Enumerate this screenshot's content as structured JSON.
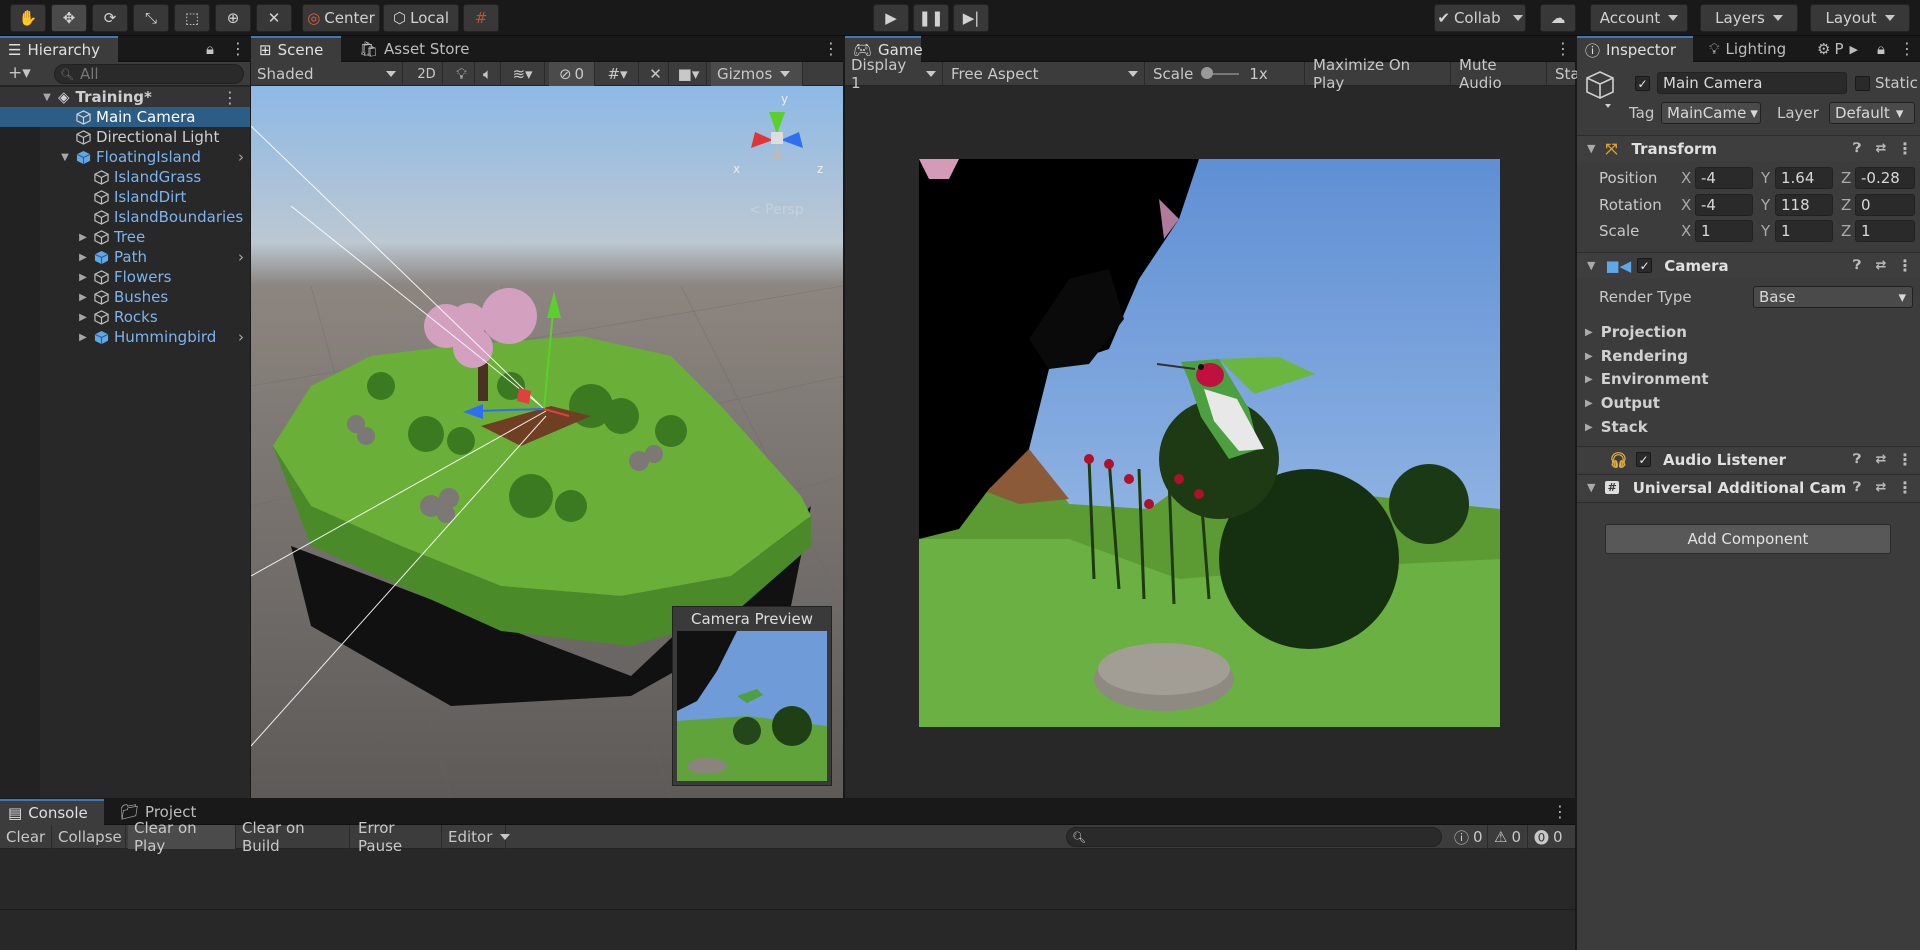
{
  "toolbar": {
    "pivot_label": "Center",
    "space_label": "Local",
    "collab_label": "Collab",
    "account_label": "Account",
    "layers_label": "Layers",
    "layout_label": "Layout"
  },
  "hierarchy": {
    "tab": "Hierarchy",
    "search_placeholder": "All",
    "scene": "Training*",
    "items": [
      {
        "label": "Main Camera"
      },
      {
        "label": "Directional Light"
      },
      {
        "label": "FloatingIsland"
      },
      {
        "label": "IslandGrass"
      },
      {
        "label": "IslandDirt"
      },
      {
        "label": "IslandBoundaries"
      },
      {
        "label": "Tree"
      },
      {
        "label": "Path"
      },
      {
        "label": "Flowers"
      },
      {
        "label": "Bushes"
      },
      {
        "label": "Rocks"
      },
      {
        "label": "Hummingbird"
      }
    ]
  },
  "scene_view": {
    "tabs": [
      "Scene",
      "Asset Store"
    ],
    "shading": "Shaded",
    "mode_2d": "2D",
    "hidden_count": "0",
    "gizmos": "Gizmos",
    "gizmo_y": "y",
    "gizmo_x": "x",
    "gizmo_z": "z",
    "persp": "< Persp",
    "camera_preview": "Camera Preview"
  },
  "game_view": {
    "tab": "Game",
    "display": "Display 1",
    "aspect": "Free Aspect",
    "scale_label": "Scale",
    "scale_value": "1x",
    "maximize": "Maximize On Play",
    "mute": "Mute Audio",
    "stats": "Stat"
  },
  "inspector": {
    "tabs": [
      "Inspector",
      "Lighting",
      "P"
    ],
    "object_name": "Main Camera",
    "static_label": "Static",
    "tag_label": "Tag",
    "tag_value": "MainCame",
    "layer_label": "Layer",
    "layer_value": "Default",
    "transform": {
      "title": "Transform",
      "position_label": "Position",
      "rotation_label": "Rotation",
      "scale_label": "Scale",
      "axis_x": "X",
      "axis_y": "Y",
      "axis_z": "Z",
      "position": [
        "-4",
        "1.64",
        "-0.28"
      ],
      "rotation": [
        "-4",
        "118",
        "0"
      ],
      "scale": [
        "1",
        "1",
        "1"
      ]
    },
    "camera": {
      "title": "Camera",
      "render_type_label": "Render Type",
      "render_type_value": "Base",
      "sections": [
        "Projection",
        "Rendering",
        "Environment",
        "Output",
        "Stack"
      ]
    },
    "audio_listener": "Audio Listener",
    "universal_cam": "Universal Additional Cam",
    "add_component": "Add Component"
  },
  "console": {
    "tabs": [
      "Console",
      "Project"
    ],
    "buttons": [
      "Clear",
      "Collapse",
      "Clear on Play",
      "Clear on Build",
      "Error Pause",
      "Editor"
    ],
    "log_count": "0",
    "warn_count": "0",
    "error_count": "0"
  },
  "colors": {
    "accent": "#3a79bb",
    "selection": "#2c5d87",
    "prefab_text": "#7bb4ef",
    "grass": "#6aab3f",
    "sky": "#6f9bd8"
  }
}
